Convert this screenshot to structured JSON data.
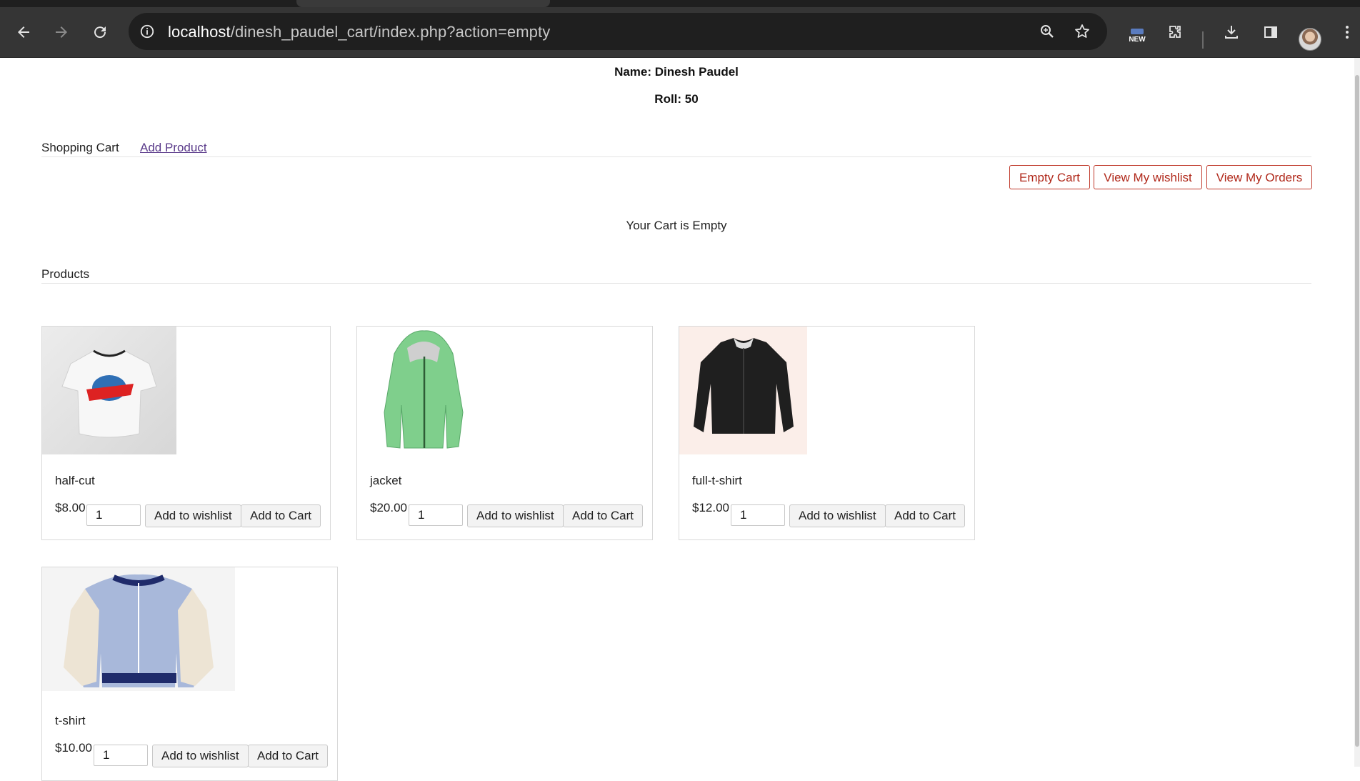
{
  "browser": {
    "url_host": "localhost",
    "url_path": "/dinesh_paudel_cart/index.php?action=empty",
    "new_badge": "NEW"
  },
  "header": {
    "name_line": "Name: Dinesh Paudel",
    "roll_line": "Roll: 50"
  },
  "cart": {
    "title": "Shopping Cart",
    "add_product_link": "Add Product",
    "empty_button": "Empty Cart",
    "wishlist_button": "View My wishlist",
    "orders_button": "View My Orders",
    "empty_message": "Your Cart is Empty"
  },
  "products": {
    "heading": "Products",
    "items": [
      {
        "name": "half-cut",
        "price": "$8.00",
        "qty": "1",
        "wishlist_label": "Add to wishlist",
        "cart_label": "Add to Cart"
      },
      {
        "name": "jacket",
        "price": "$20.00",
        "qty": "1",
        "wishlist_label": "Add to wishlist",
        "cart_label": "Add to Cart"
      },
      {
        "name": "full-t-shirt",
        "price": "$12.00",
        "qty": "1",
        "wishlist_label": "Add to wishlist",
        "cart_label": "Add to Cart"
      },
      {
        "name": "t-shirt",
        "price": "$10.00",
        "qty": "1",
        "wishlist_label": "Add to wishlist",
        "cart_label": "Add to Cart"
      }
    ]
  },
  "colors": {
    "chrome_bg": "#353535",
    "accent_red": "#c0392b",
    "link_purple": "#5a3a8a"
  }
}
